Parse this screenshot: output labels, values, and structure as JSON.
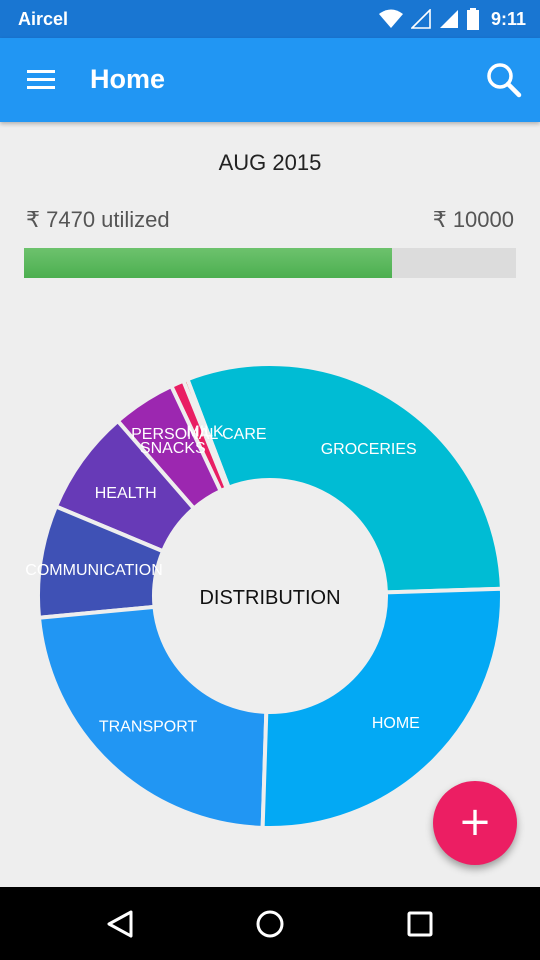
{
  "status_bar": {
    "carrier": "Aircel",
    "time": "9:11"
  },
  "app_bar": {
    "title": "Home",
    "menu_icon": "hamburger-menu-icon",
    "search_icon": "search-icon"
  },
  "summary": {
    "month": "AUG 2015",
    "utilized_text": "₹ 7470 utilized",
    "budget_text": "₹ 10000",
    "utilized": 7470,
    "budget": 10000,
    "progress_fraction": 0.747
  },
  "chart_data": {
    "type": "pie",
    "center_label": "DISTRIBUTION",
    "slices": [
      {
        "label": "GROCERIES",
        "value": 30.3,
        "color": "#00bcd4"
      },
      {
        "label": "MILK",
        "value": 0.3,
        "color": "#f44336"
      },
      {
        "label": "PERSONAL CARE",
        "value": 0.9,
        "color": "#e91e63"
      },
      {
        "label": "SNACKS",
        "value": 4.4,
        "color": "#9c27b0"
      },
      {
        "label": "HEALTH",
        "value": 7.3,
        "color": "#673ab7"
      },
      {
        "label": "COMMUNICATION",
        "value": 7.8,
        "color": "#3f51b5"
      },
      {
        "label": "TRANSPORT",
        "value": 23.0,
        "color": "#2196f3"
      },
      {
        "label": "HOME",
        "value": 26.0,
        "color": "#03a9f4"
      }
    ]
  },
  "fab": {
    "label": "+",
    "color": "#ec1e63"
  },
  "nav_bar": {
    "back_icon": "back-triangle-icon",
    "home_icon": "home-circle-icon",
    "recents_icon": "recents-square-icon"
  }
}
